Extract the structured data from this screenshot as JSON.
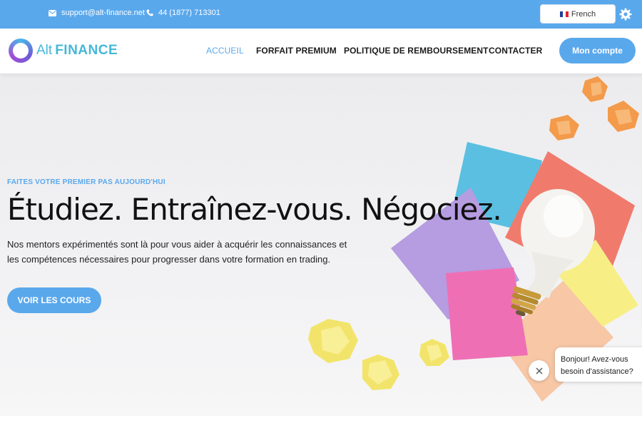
{
  "topbar": {
    "email": "support@alt-finance.net",
    "phone": "44 (1877) 713301",
    "language": "French",
    "icons": {
      "email": "envelope-icon",
      "phone": "phone-icon",
      "settings": "gear-icon"
    }
  },
  "nav": {
    "logo_alt": "Alt",
    "logo_finance": "FINANCE",
    "items": [
      {
        "label": "ACCUEIL",
        "active": true
      },
      {
        "label": "FORFAIT PREMIUM",
        "active": false
      },
      {
        "label": "POLITIQUE DE REMBOURSEMENT",
        "active": false
      },
      {
        "label": "CONTACTER",
        "active": false
      }
    ],
    "account_button": "Mon compte"
  },
  "hero": {
    "eyebrow": "FAITES VOTRE PREMIER PAS AUJOURD'HUI",
    "headline": "Étudiez. Entraînez-vous. Négociez.",
    "subtext": "Nos mentors expérimentés sont là pour vous aider à acquérir les connaissances et les compétences nécessaires pour progresser dans votre formation en trading.",
    "cta": "VOIR LES COURS"
  },
  "chat": {
    "message": "Bonjour! Avez-vous besoin d'assistance?"
  },
  "colors": {
    "accent": "#5aa8ec",
    "logo": "#45b8d9",
    "text": "#111111"
  }
}
